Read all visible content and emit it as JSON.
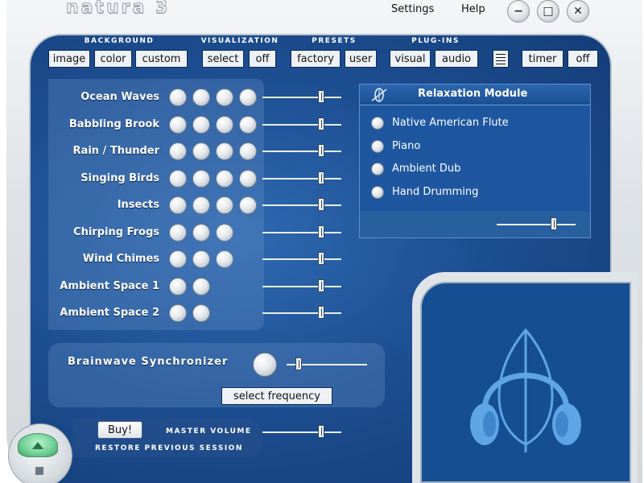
{
  "app": {
    "title": "natura 3"
  },
  "menu": {
    "settings": "Settings",
    "help": "Help"
  },
  "window_controls": {
    "minimize": "−",
    "maximize": "□",
    "close": "✕"
  },
  "sections": {
    "background": {
      "label": "BACKGROUND",
      "buttons": [
        "image",
        "color",
        "custom"
      ]
    },
    "visualization": {
      "label": "VISUALIZATION",
      "buttons": [
        "select",
        "off"
      ]
    },
    "presets": {
      "label": "PRESETS",
      "buttons": [
        "factory",
        "user"
      ]
    },
    "plugins": {
      "label": "PLUG-INS",
      "buttons": [
        "visual",
        "audio"
      ]
    },
    "timer": {
      "buttons": [
        "timer",
        "off"
      ]
    }
  },
  "sounds": [
    {
      "label": "Ocean Waves",
      "variants": 4,
      "volume": 0.74
    },
    {
      "label": "Babbling Brook",
      "variants": 4,
      "volume": 0.74
    },
    {
      "label": "Rain / Thunder",
      "variants": 4,
      "volume": 0.74
    },
    {
      "label": "Singing Birds",
      "variants": 4,
      "volume": 0.74
    },
    {
      "label": "Insects",
      "variants": 4,
      "volume": 0.74
    },
    {
      "label": "Chirping Frogs",
      "variants": 3,
      "volume": 0.74
    },
    {
      "label": "Wind Chimes",
      "variants": 3,
      "volume": 0.74
    },
    {
      "label": "Ambient Space 1",
      "variants": 2,
      "volume": 0.74
    },
    {
      "label": "Ambient Space 2",
      "variants": 2,
      "volume": 0.74
    }
  ],
  "relaxation": {
    "title": "Relaxation Module",
    "items": [
      "Native American Flute",
      "Piano",
      "Ambient Dub",
      "Hand Drumming"
    ],
    "volume": 0.72
  },
  "brainwave": {
    "title": "Brainwave Synchronizer",
    "button": "select frequency",
    "level": 0.15
  },
  "bottom": {
    "buy": "Buy!",
    "master_volume_label": "MASTER VOLUME",
    "master_volume": 0.74,
    "restore": "RESTORE PREVIOUS SESSION"
  },
  "colors": {
    "panel_blue": "#1d4f93",
    "visual_blue": "#154e92",
    "headphone_blue": "#5ea5e6",
    "play_green": "#6fcf93"
  },
  "icons": {
    "relax": "leaf-crossed-icon",
    "visual": "headphones-leaf-icon",
    "list": "list-icon"
  }
}
